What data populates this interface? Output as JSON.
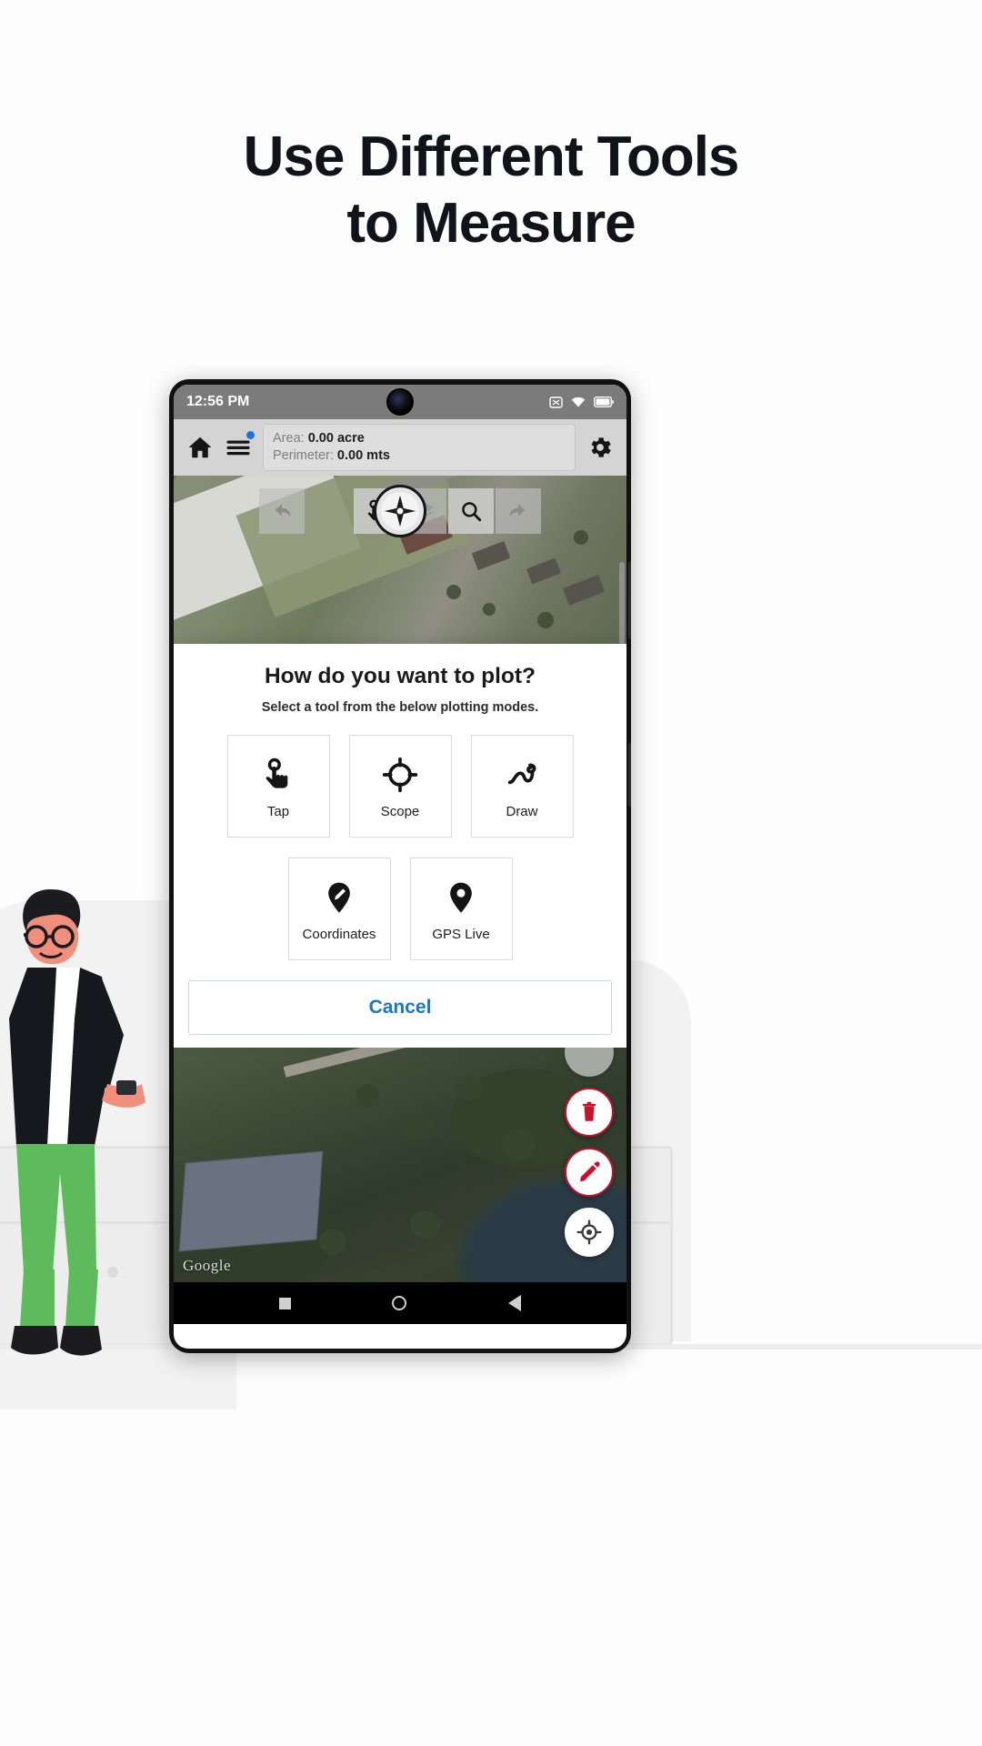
{
  "promo": {
    "heading_line1": "Use Different Tools",
    "heading_line2": "to Measure"
  },
  "statusbar": {
    "time": "12:56 PM",
    "icons": [
      "sim-card-icon",
      "wifi-icon",
      "battery-icon"
    ]
  },
  "toolbar": {
    "home_icon": "home-icon",
    "menu_icon": "hamburger-menu-icon",
    "settings_icon": "gear-icon",
    "area_label": "Area:",
    "area_value": "0.00 acre",
    "perimeter_label": "Perimeter:",
    "perimeter_value": "0.00 mts"
  },
  "map_tools": {
    "undo": "undo-icon",
    "compass": "compass-icon",
    "tap": "tap-hand-icon",
    "layers": "layers-icon",
    "search": "search-icon",
    "redo": "redo-icon"
  },
  "sheet": {
    "title": "How do you want to plot?",
    "subtitle": "Select a tool from the below plotting modes.",
    "tools_row1": [
      {
        "label": "Tap",
        "icon": "tap-hand-icon"
      },
      {
        "label": "Scope",
        "icon": "crosshair-scope-icon"
      },
      {
        "label": "Draw",
        "icon": "draw-squiggle-icon"
      }
    ],
    "tools_row2": [
      {
        "label": "Coordinates",
        "icon": "map-pin-pencil-icon"
      },
      {
        "label": "GPS Live",
        "icon": "map-pin-icon"
      }
    ],
    "cancel_label": "Cancel"
  },
  "map_fabs": [
    {
      "name": "delete-fab",
      "icon": "trash-icon"
    },
    {
      "name": "edit-fab",
      "icon": "pencil-icon"
    },
    {
      "name": "my-location-fab",
      "icon": "crosshair-location-icon"
    }
  ],
  "map_watermark": "Google",
  "navbar": {
    "recents": "square-icon",
    "home": "circle-icon",
    "back": "triangle-back-icon"
  },
  "colors": {
    "accent_blue": "#1877c9",
    "badge_blue": "#1b74e4",
    "fab_red": "#c8112a",
    "heading": "#11131a"
  }
}
